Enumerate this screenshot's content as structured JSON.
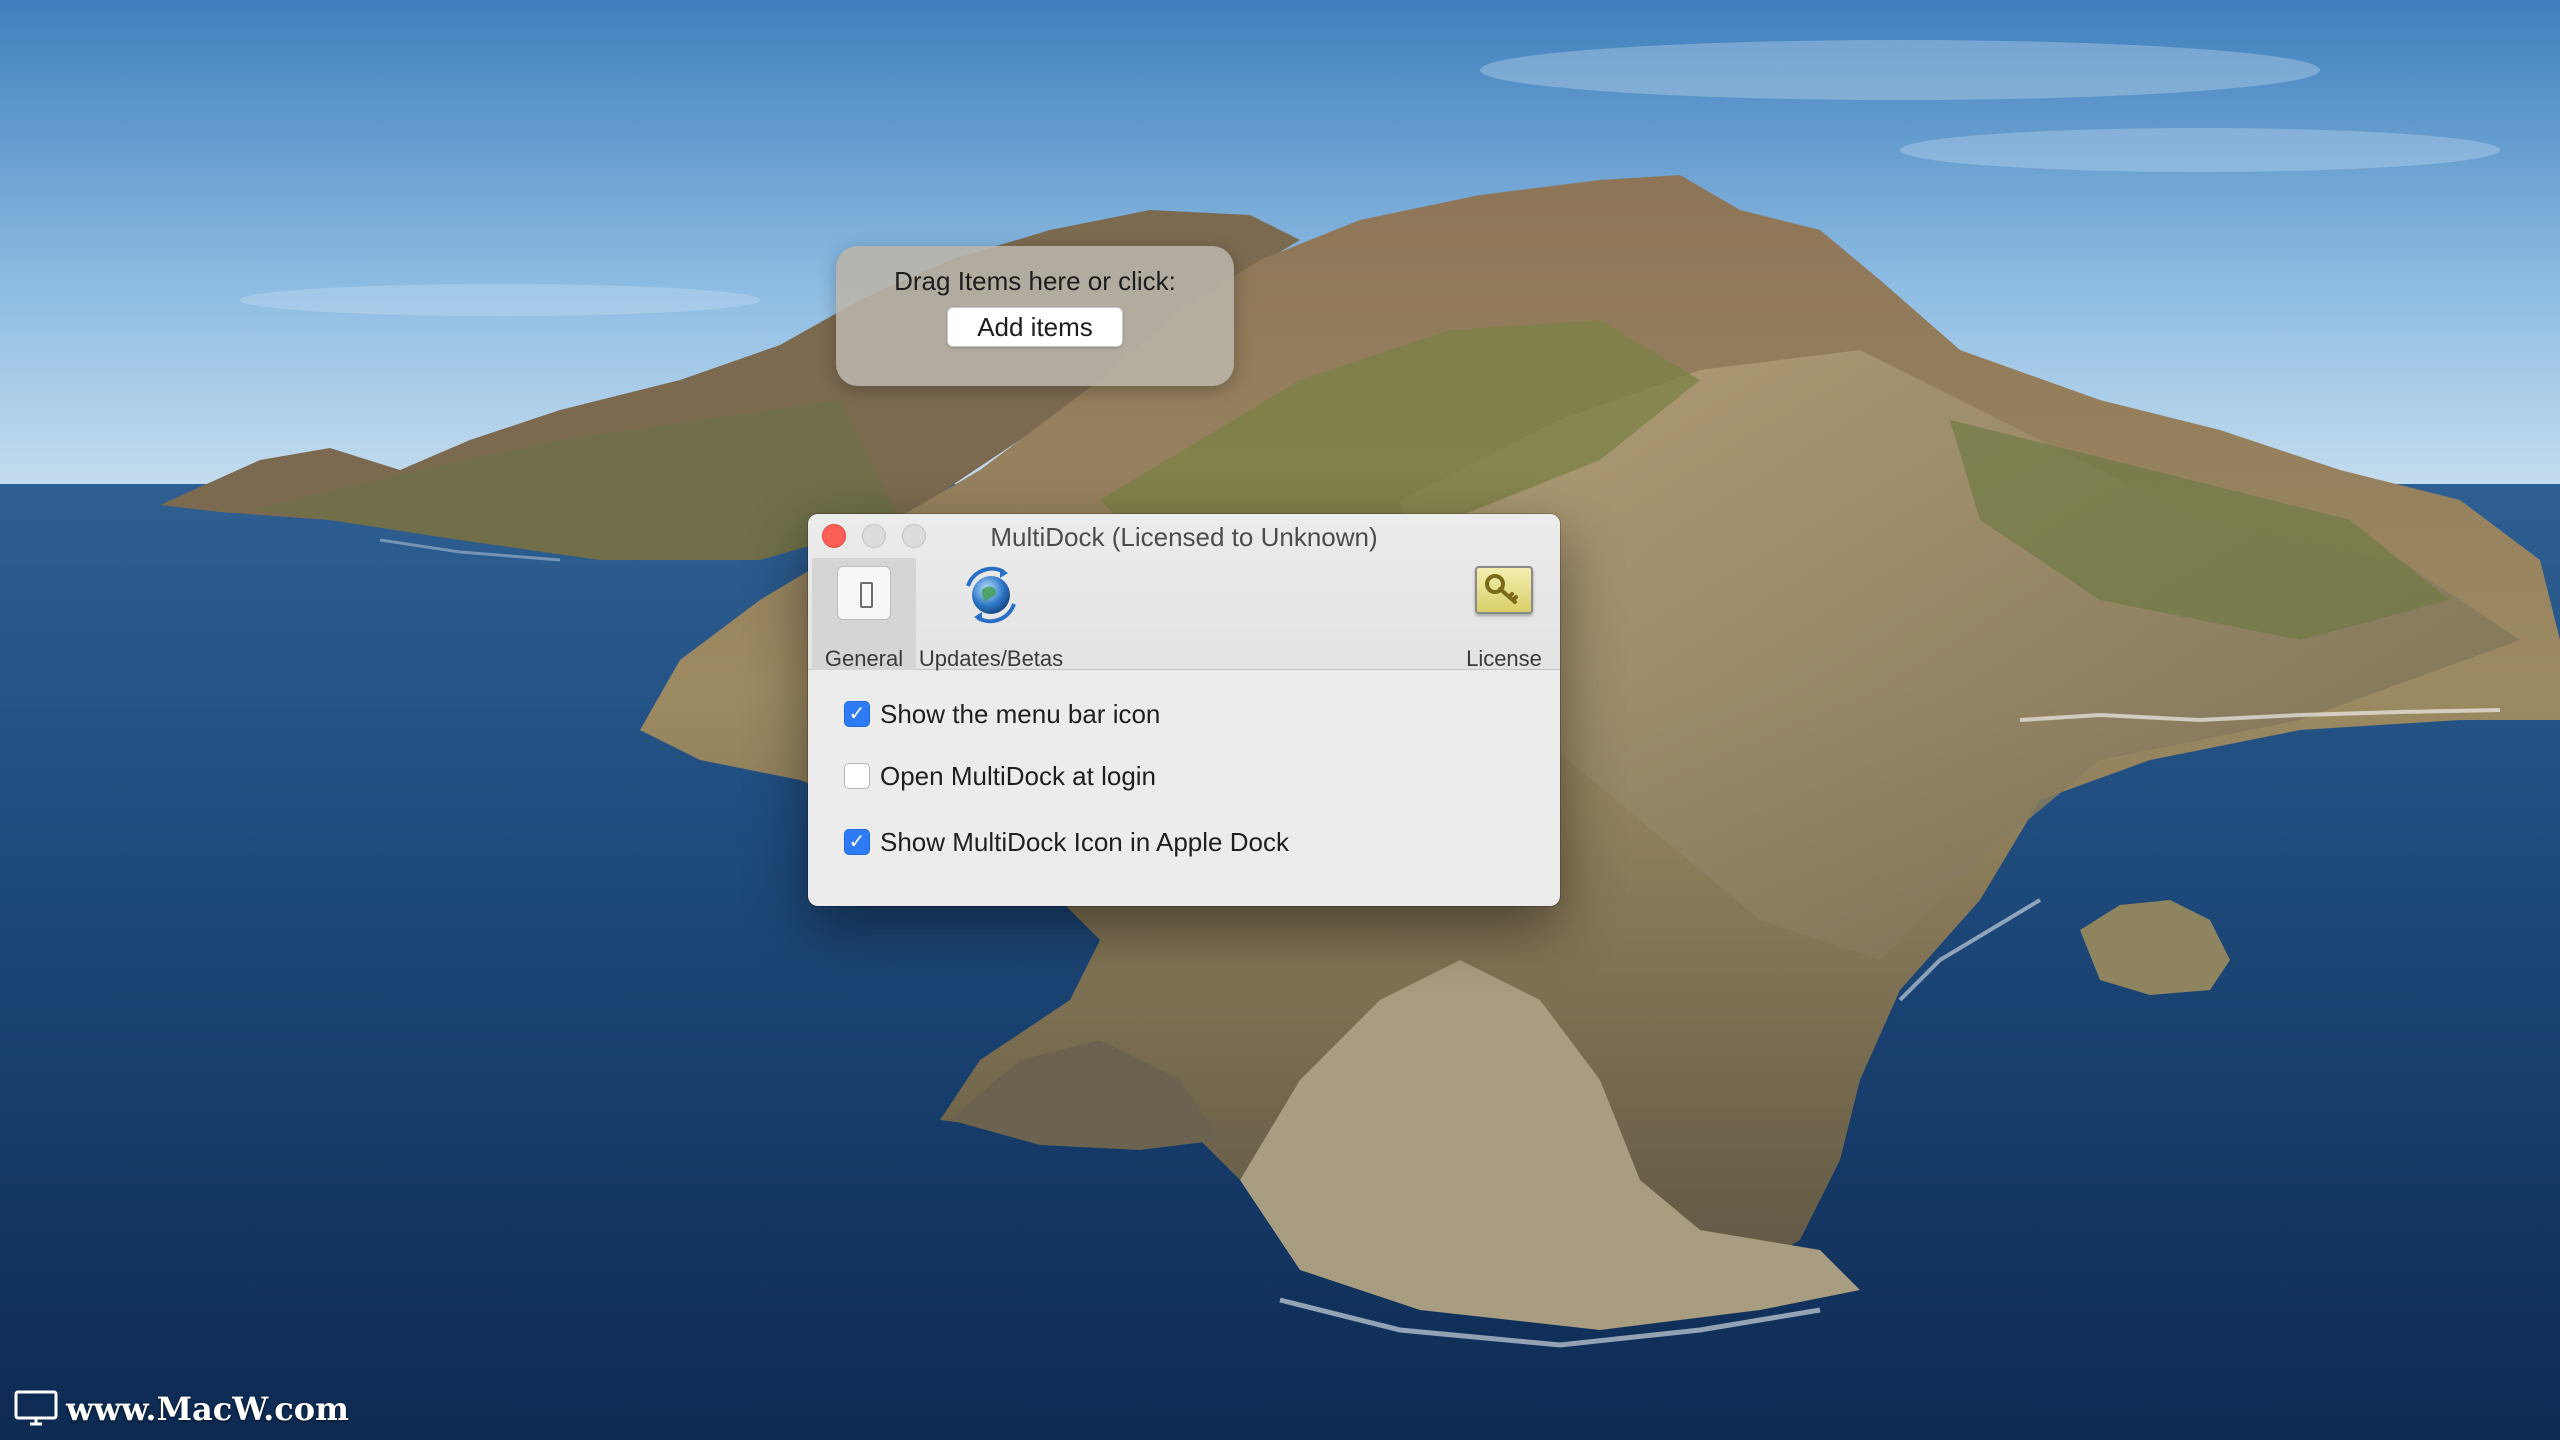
{
  "dropzone": {
    "prompt": "Drag Items here or click:",
    "add_button": "Add items"
  },
  "window": {
    "title": "MultiDock (Licensed to Unknown)",
    "traffic_lights": [
      "close",
      "minimize",
      "zoom"
    ],
    "toolbar": [
      {
        "label": "General",
        "icon": "general-switch-icon",
        "selected": true
      },
      {
        "label": "Updates/Betas",
        "icon": "updates-globe-icon",
        "selected": false
      },
      {
        "label": "License",
        "icon": "license-key-icon",
        "selected": false
      }
    ],
    "settings": [
      {
        "label": "Show the menu bar icon",
        "checked": true
      },
      {
        "label": "Open MultiDock at login",
        "checked": false
      },
      {
        "label": "Show MultiDock Icon in Apple Dock",
        "checked": true
      }
    ]
  },
  "watermark": {
    "text": "www.MacW.com"
  },
  "colors": {
    "accent": "#2d7cf6",
    "close_button": "#fe5f57",
    "window_bg": "#ececec"
  }
}
